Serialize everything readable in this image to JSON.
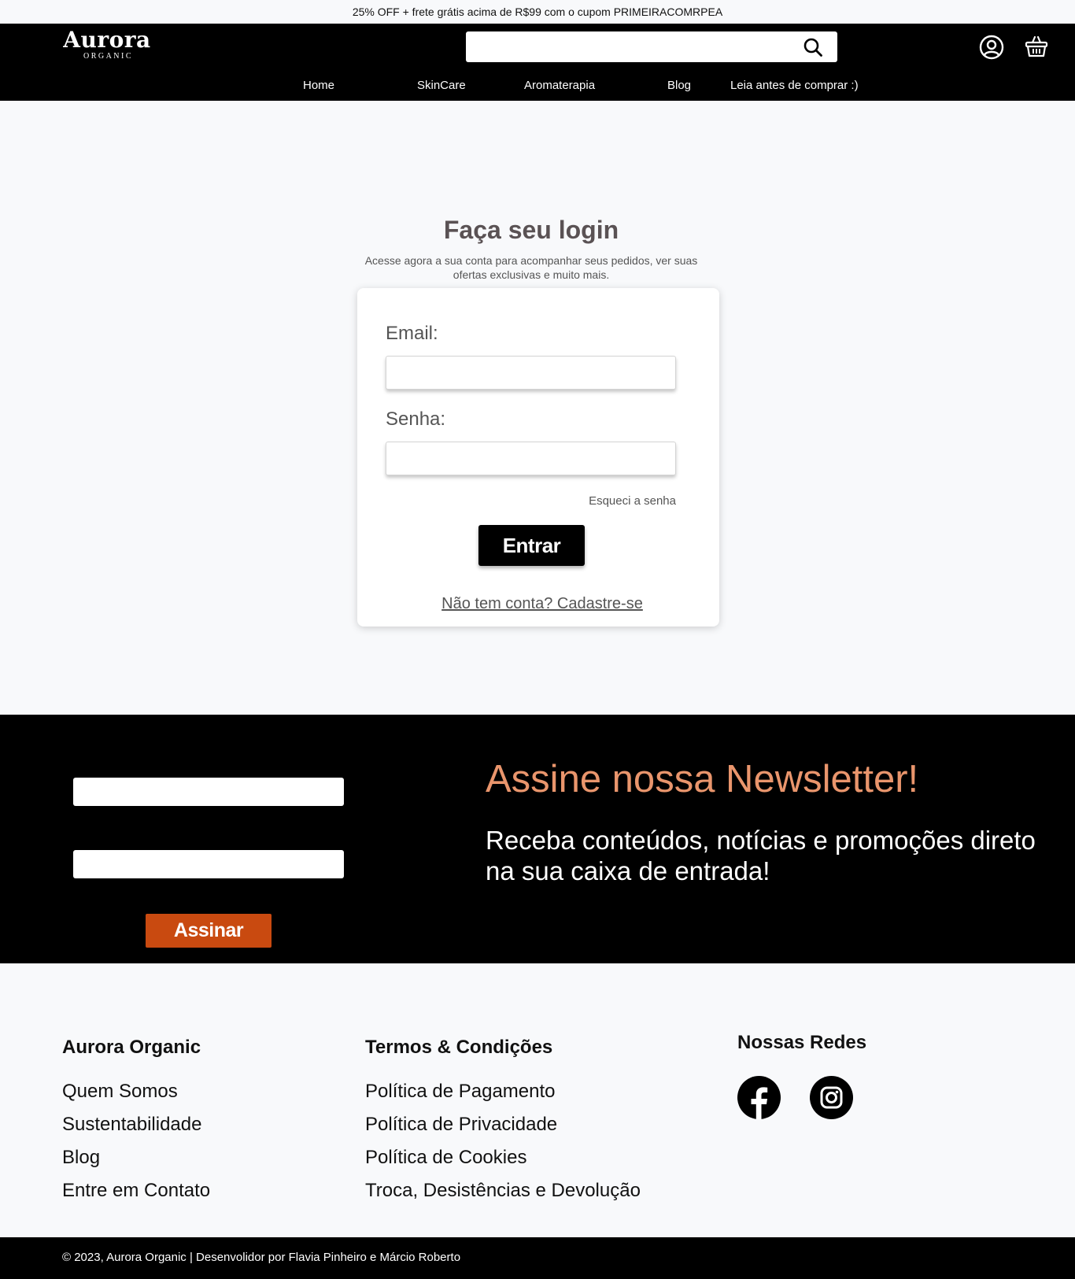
{
  "promo": {
    "text": "25% OFF + frete grátis acima de R$99 com o cupom PRIMEIRACOMRPEA"
  },
  "header": {
    "logo_main": "Aurora",
    "logo_sub": "ORGANIC",
    "search": {
      "value": "",
      "placeholder": ""
    },
    "icons": [
      "search-icon",
      "user-icon",
      "cart-icon"
    ],
    "nav": [
      {
        "label": "Home"
      },
      {
        "label": "SkinCare"
      },
      {
        "label": "Aromaterapia"
      },
      {
        "label": "Blog"
      },
      {
        "label": "Leia antes de comprar :)"
      }
    ]
  },
  "login": {
    "title": "Faça seu login",
    "subtitle": "Acesse agora a sua conta para acompanhar seus pedidos, ver suas ofertas exclusivas e muito mais.",
    "email_label": "Email:",
    "email_value": "",
    "password_label": "Senha:",
    "password_value": "",
    "forgot_label": "Esqueci a senha",
    "submit_label": "Entrar",
    "signup_label": "Não tem conta? Cadastre-se"
  },
  "newsletter": {
    "input1_value": "",
    "input2_value": "",
    "button_label": "Assinar",
    "title": "Assine nossa Newsletter!",
    "text": "Receba conteúdos, notícias e promoções direto na sua caixa de entrada!"
  },
  "footer": {
    "col1": {
      "title": "Aurora Organic",
      "links": [
        "Quem Somos",
        "Sustentabilidade",
        "Blog",
        "Entre em Contato"
      ]
    },
    "col2": {
      "title": "Termos & Condições",
      "links": [
        "Política de Pagamento",
        "Política de Privacidade",
        "Política de Cookies",
        "Troca, Desistências e Devolução"
      ]
    },
    "col3": {
      "title": "Nossas Redes",
      "icons": [
        "facebook-icon",
        "instagram-icon"
      ]
    },
    "copyright": "© 2023, Aurora Organic | Desenvolidor por Flavia Pinheiro e Márcio Roberto"
  },
  "colors": {
    "header_bg": "#000000",
    "accent_orange": "#e9956c",
    "button_orange": "#c94a10",
    "page_bg": "#f8f9fb"
  }
}
